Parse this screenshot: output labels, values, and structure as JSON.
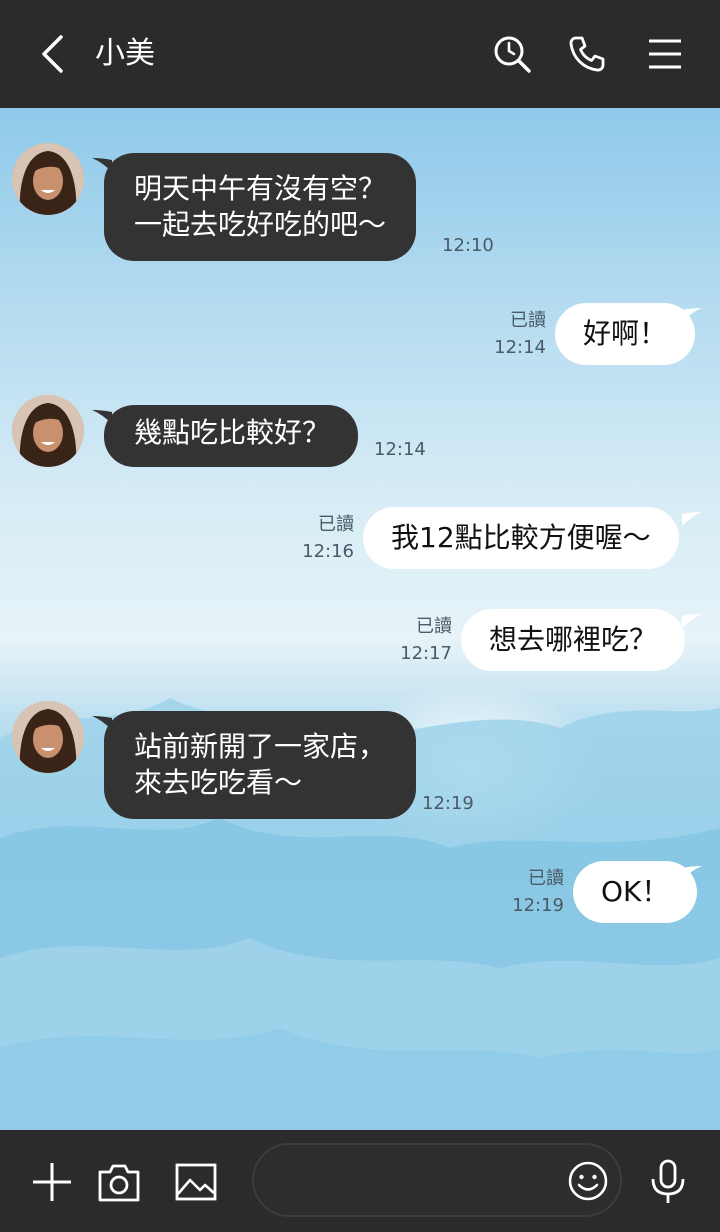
{
  "header": {
    "title": "小美",
    "back_icon": "chevron-left-icon",
    "search_icon": "search-icon",
    "call_icon": "phone-icon",
    "menu_icon": "hamburger-menu-icon"
  },
  "messages": [
    {
      "side": "in",
      "text_lines": [
        "明天中午有沒有空？",
        "一起去吃好吃的吧～"
      ],
      "time": "12:10"
    },
    {
      "side": "out",
      "text": "好啊！",
      "read": "已讀",
      "time": "12:14"
    },
    {
      "side": "in",
      "text": "幾點吃比較好？",
      "time": "12:14"
    },
    {
      "side": "out",
      "text": "我12點比較方便喔～",
      "read": "已讀",
      "time": "12:16"
    },
    {
      "side": "out",
      "text": "想去哪裡吃？",
      "read": "已讀",
      "time": "12:17"
    },
    {
      "side": "in",
      "text_lines": [
        "站前新開了一家店，",
        "來去吃吃看～"
      ],
      "time": "12:19"
    },
    {
      "side": "out",
      "text": "OK！",
      "read": "已讀",
      "time": "12:19"
    }
  ],
  "composer": {
    "placeholder": "",
    "icons": [
      "plus-icon",
      "camera-icon",
      "image-icon",
      "emoji-icon",
      "microphone-icon"
    ]
  },
  "colors": {
    "bar_background": "#2b2b2b",
    "incoming_bubble": "#333333",
    "outgoing_bubble": "#ffffff"
  }
}
